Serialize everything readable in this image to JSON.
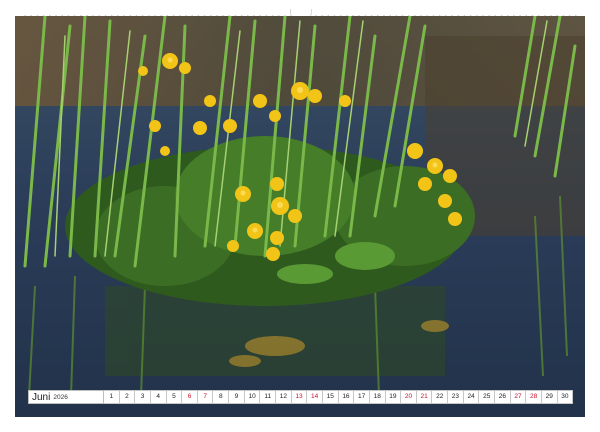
{
  "calendar": {
    "month": "Juni",
    "year": "2026",
    "days": [
      {
        "label": "1",
        "weekend": false
      },
      {
        "label": "2",
        "weekend": false
      },
      {
        "label": "3",
        "weekend": false
      },
      {
        "label": "4",
        "weekend": false
      },
      {
        "label": "5",
        "weekend": false
      },
      {
        "label": "6",
        "weekend": true
      },
      {
        "label": "7",
        "weekend": true
      },
      {
        "label": "8",
        "weekend": false
      },
      {
        "label": "9",
        "weekend": false
      },
      {
        "label": "10",
        "weekend": false
      },
      {
        "label": "11",
        "weekend": false
      },
      {
        "label": "12",
        "weekend": false
      },
      {
        "label": "13",
        "weekend": true
      },
      {
        "label": "14",
        "weekend": true
      },
      {
        "label": "15",
        "weekend": false
      },
      {
        "label": "16",
        "weekend": false
      },
      {
        "label": "17",
        "weekend": false
      },
      {
        "label": "18",
        "weekend": false
      },
      {
        "label": "19",
        "weekend": false
      },
      {
        "label": "20",
        "weekend": true
      },
      {
        "label": "21",
        "weekend": true
      },
      {
        "label": "22",
        "weekend": false
      },
      {
        "label": "23",
        "weekend": false
      },
      {
        "label": "24",
        "weekend": false
      },
      {
        "label": "25",
        "weekend": false
      },
      {
        "label": "26",
        "weekend": false
      },
      {
        "label": "27",
        "weekend": true
      },
      {
        "label": "28",
        "weekend": true
      },
      {
        "label": "29",
        "weekend": false
      },
      {
        "label": "30",
        "weekend": false
      }
    ],
    "colors": {
      "weekday_text": "#222222",
      "weekend_text": "#c8102e",
      "border": "#c6c6c6"
    }
  },
  "photo": {
    "subject": "yellow marsh marigolds among green reeds reflected in pond water",
    "colors": {
      "water": "#2a3a52",
      "reed_green": "#6fa843",
      "flower_yellow": "#f2c418"
    }
  }
}
